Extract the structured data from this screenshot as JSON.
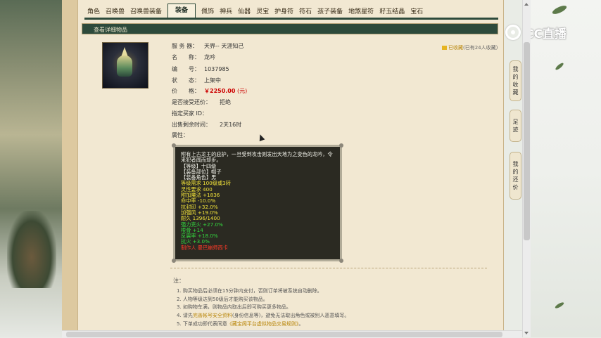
{
  "nav": {
    "tabs": [
      "角色",
      "召唤兽",
      "召唤兽装备",
      "装备",
      "佩饰",
      "神兵",
      "仙器",
      "灵宝",
      "护身符",
      "符石",
      "孩子装备",
      "地煞星符",
      "籽玉结晶",
      "宝石"
    ],
    "active_index": 3
  },
  "section_title": "查看详细物品",
  "favorite": {
    "link_text": "已收藏",
    "count_text": "(已有24人收藏)"
  },
  "item": {
    "server_label": "服 务 器：",
    "server": "天界-- 天涯知己",
    "name_label": "名　　称：",
    "name": "龙吟",
    "id_label": "编　　号：",
    "id": "1037985",
    "status_label": "状　　态：",
    "status": "上架中",
    "price_label": "价　　格：",
    "price": "￥2250.00",
    "price_unit": "(元)",
    "bargain_label": "是否接受还价：",
    "bargain": "拒绝",
    "buyer_label": "指定买家 ID：",
    "buyer": "",
    "time_label": "出售剩余时间：",
    "time": "2天16时",
    "attr_label": "属性："
  },
  "description": [
    {
      "text": "附有上古龙王的庇护，一旦受到攻击则发出天地为之变色的龙吟，令",
      "color": "white"
    },
    {
      "text": "来犯者闻而却步。",
      "color": "white"
    },
    {
      "text": "【等级】十四级",
      "color": "white"
    },
    {
      "text": "【装备部位】帽子",
      "color": "white"
    },
    {
      "text": "【装备角色】男",
      "color": "white"
    },
    {
      "text": "等级需求 100级或3转",
      "color": "yellow"
    },
    {
      "text": "灵性要求 400",
      "color": "yellow"
    },
    {
      "text": "附加魔法 +1836",
      "color": "yellow"
    },
    {
      "text": "命中率 -10.0%",
      "color": "yellow"
    },
    {
      "text": "抗封印 +32.0%",
      "color": "yellow"
    },
    {
      "text": "加强风 +19.0%",
      "color": "yellow"
    },
    {
      "text": "耐久 1396/1400",
      "color": "yellow"
    },
    {
      "text": "强力克火 +27.0%",
      "color": "green"
    },
    {
      "text": "根骨 +14",
      "color": "green"
    },
    {
      "text": "反震率 +18.0%",
      "color": "green"
    },
    {
      "text": "抗火 +3.0%",
      "color": "green"
    },
    {
      "text": "制作人 曼巴崩师西卡",
      "color": "red"
    }
  ],
  "notes": {
    "title": "注：",
    "items": [
      {
        "text": "1. 购买物品后必须在15分钟内支付，否则订单将被系统自动删除。",
        "link": ""
      },
      {
        "text": "2. 人物等级达到50级后才能购买该物品。",
        "link": ""
      },
      {
        "text": "3. 如购物车满，则物品内取出后即可购买更多物品。",
        "link": ""
      },
      {
        "text": "4. 请先",
        "link": "完善帐号安全资料",
        "after": "(身份信息等)，避免无法取出角色或被别人恶意填写。"
      },
      {
        "text": "5. 下单成功即代表同意",
        "link": "《藏宝阁平台虚拟物品交易规则》",
        "after": "。"
      }
    ]
  },
  "side_tabs": [
    {
      "label": "我的收藏"
    },
    {
      "label": "足迹"
    },
    {
      "label": "我的还价"
    }
  ],
  "logo_text": "CC直播",
  "colors": {
    "nav": "#2d4a3b",
    "price": "#cc0000",
    "link": "#b8860b"
  }
}
